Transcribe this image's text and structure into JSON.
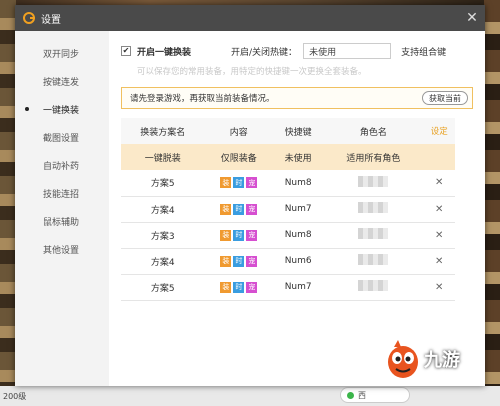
{
  "window": {
    "title": "设置"
  },
  "sidebar": {
    "items": [
      {
        "label": "双开同步",
        "active": false
      },
      {
        "label": "按键连发",
        "active": false
      },
      {
        "label": "一键换装",
        "active": true
      },
      {
        "label": "截图设置",
        "active": false
      },
      {
        "label": "自动补药",
        "active": false
      },
      {
        "label": "技能连招",
        "active": false
      },
      {
        "label": "鼠标辅助",
        "active": false
      },
      {
        "label": "其他设置",
        "active": false
      }
    ]
  },
  "feature": {
    "enable_label": "开启一键换装",
    "enabled": true,
    "hotkey_label": "开启/关闭热键：",
    "hotkey_value": "未使用",
    "combo_label": "支持组合键",
    "hint": "可以保存您的常用装备，用特定的快捷键一次更换全套装备。"
  },
  "notice": {
    "text": "请先登录游戏，再获取当前装备情况。",
    "button": "获取当前"
  },
  "table": {
    "headers": [
      "换装方案名",
      "内容",
      "快捷键",
      "角色名"
    ],
    "edit_label": "设定",
    "default_row": {
      "name": "一键脱装",
      "content": "仅限装备",
      "key": "未使用",
      "role": "适用所有角色"
    },
    "tag_labels": [
      "装",
      "时",
      "宠"
    ],
    "rows": [
      {
        "name": "方案5",
        "key": "Num8"
      },
      {
        "name": "方案4",
        "key": "Num7"
      },
      {
        "name": "方案3",
        "key": "Num8"
      },
      {
        "name": "方案4",
        "key": "Num6"
      },
      {
        "name": "方案5",
        "key": "Num7"
      }
    ],
    "delete_glyph": "✕"
  },
  "taskbar": {
    "left_text": "200级",
    "btn_text": "西"
  },
  "watermark": {
    "brand": "九游"
  },
  "colors": {
    "titlebar": "#4a4a4a",
    "accent": "#f0a020",
    "default_row": "#fbe9c9",
    "tag_orange": "#f09a30",
    "tag_blue": "#3a9de0",
    "tag_pink": "#d64fd0"
  }
}
